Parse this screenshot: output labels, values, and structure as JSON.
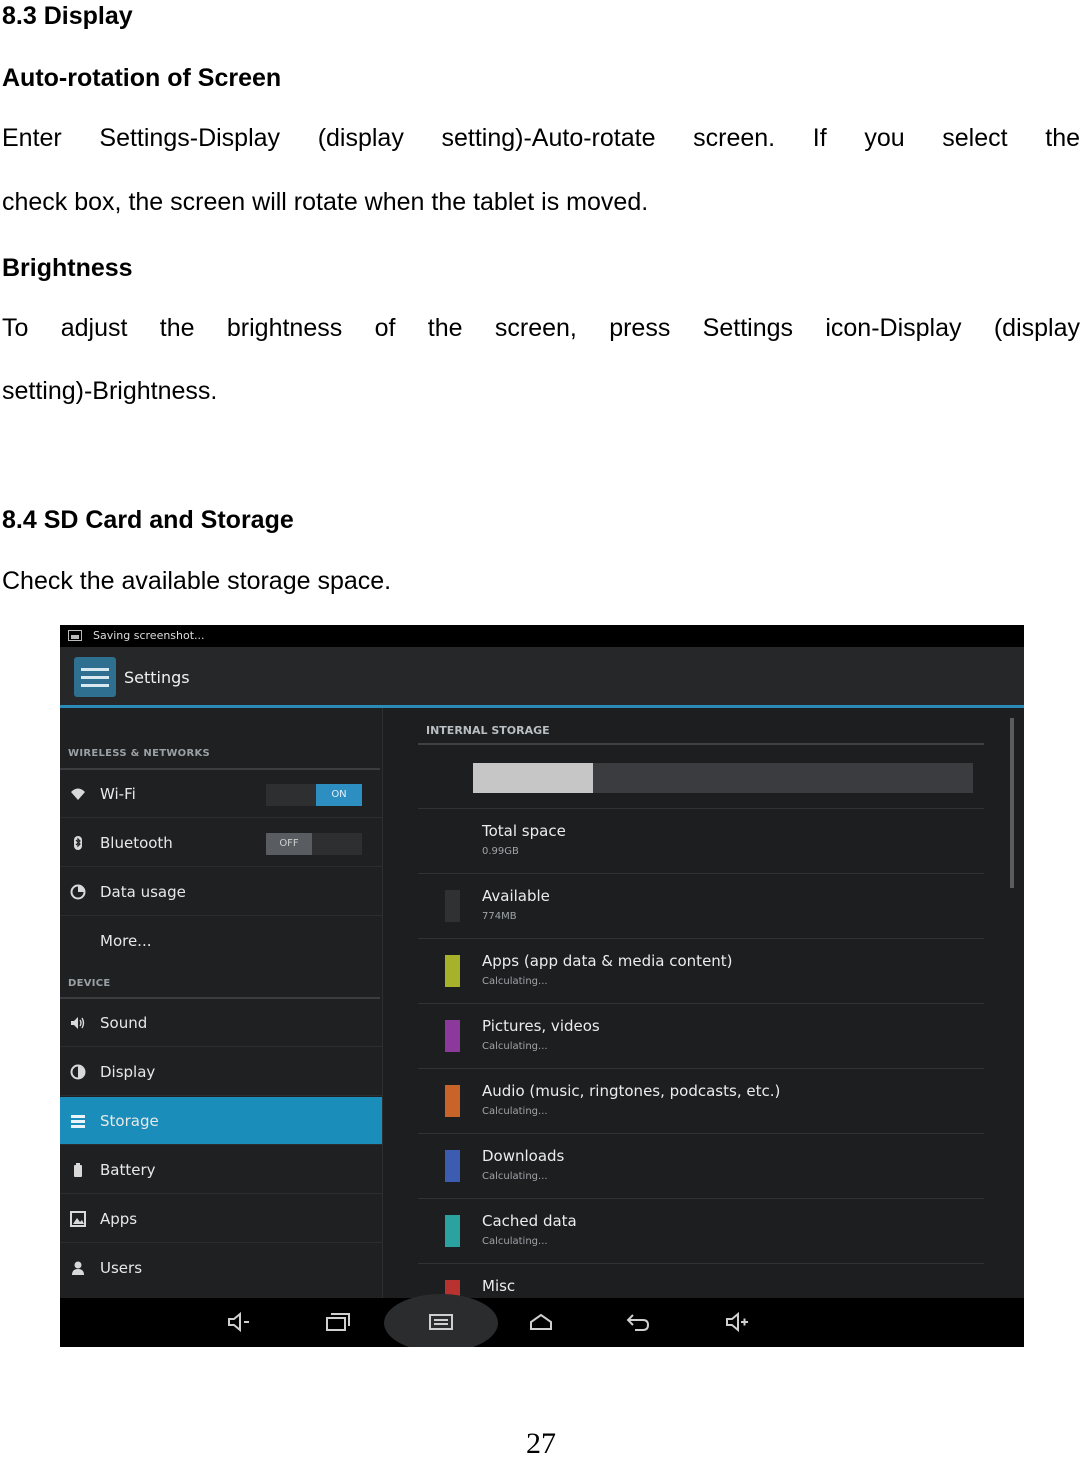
{
  "display_section": {
    "heading": "8.3 Display",
    "auto_rotation_heading": "Auto-rotation of Screen",
    "auto_rotation_line1": "Enter Settings-Display (display setting)-Auto-rotate screen. If you select the",
    "auto_rotation_line2": "check box, the screen will rotate when the tablet is moved.",
    "brightness_heading": "Brightness",
    "brightness_line1": "To adjust the brightness of the screen, press Settings icon-Display (display",
    "brightness_line2": "setting)-Brightness."
  },
  "storage_section": {
    "heading": "8.4 SD Card and Storage",
    "text": "Check the available storage space."
  },
  "screenshot": {
    "status_text": "Saving screenshot...",
    "app_title": "Settings",
    "categories": {
      "wireless": "WIRELESS & NETWORKS",
      "device": "DEVICE"
    },
    "menu": {
      "wifi": "Wi-Fi",
      "wifi_toggle": "ON",
      "bluetooth": "Bluetooth",
      "bluetooth_toggle": "OFF",
      "data_usage": "Data usage",
      "more": "More...",
      "sound": "Sound",
      "display": "Display",
      "storage": "Storage",
      "battery": "Battery",
      "apps": "Apps",
      "users": "Users"
    },
    "internal_storage": {
      "title": "INTERNAL STORAGE",
      "used_fraction": 0.24,
      "rows": [
        {
          "label": "Total space",
          "value": "0.99GB",
          "color": ""
        },
        {
          "label": "Available",
          "value": "774MB",
          "color": "#2f3133"
        },
        {
          "label": "Apps (app data & media content)",
          "value": "Calculating...",
          "color": "#a6b32a"
        },
        {
          "label": "Pictures, videos",
          "value": "Calculating...",
          "color": "#8b3a9c"
        },
        {
          "label": "Audio (music, ringtones, podcasts, etc.)",
          "value": "Calculating...",
          "color": "#c8642a"
        },
        {
          "label": "Downloads",
          "value": "Calculating...",
          "color": "#3b5cb0"
        },
        {
          "label": "Cached data",
          "value": "Calculating...",
          "color": "#2aa3a0"
        },
        {
          "label": "Misc",
          "value": "",
          "color": "#b8322f"
        }
      ]
    },
    "nav_icons": [
      "volume-down-icon",
      "recent-apps-icon",
      "screenshot-icon",
      "home-icon",
      "back-icon",
      "volume-up-icon"
    ]
  },
  "page_number": "27"
}
